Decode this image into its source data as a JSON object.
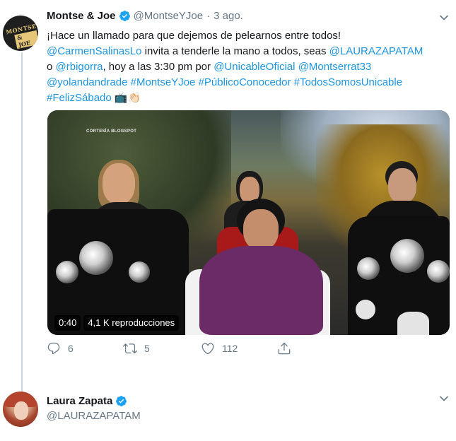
{
  "tweet": {
    "author_name": "Montse & Joe",
    "author_handle": "@MontseYJoe",
    "separator": "·",
    "time": "3 ago.",
    "avatar_text_top": "MONTSE",
    "avatar_text_bottom": "& JOE",
    "text_lines": [
      [
        {
          "t": "¡Hace un llamado para que dejemos de pelearnos entre todos!",
          "link": false
        }
      ],
      [
        {
          "t": "@CarmenSalinasLo",
          "link": true
        },
        {
          "t": " invita a tenderle la mano a todos, seas ",
          "link": false
        },
        {
          "t": "@LAURAZAPATAM",
          "link": true
        }
      ],
      [
        {
          "t": "o ",
          "link": false
        },
        {
          "t": "@rbigorra",
          "link": true
        },
        {
          "t": ", hoy a las 3:30 pm por ",
          "link": false
        },
        {
          "t": "@UnicableOficial",
          "link": true
        },
        {
          "t": " ",
          "link": false
        },
        {
          "t": "@Montserrat33",
          "link": true
        }
      ],
      [
        {
          "t": "@yolandandrade",
          "link": true
        },
        {
          "t": " ",
          "link": false
        },
        {
          "t": "#MontseYJoe",
          "link": true
        },
        {
          "t": " ",
          "link": false
        },
        {
          "t": "#PúblicoConocedor",
          "link": true
        },
        {
          "t": " ",
          "link": false
        },
        {
          "t": "#TodosSomosUnicable",
          "link": true
        }
      ],
      [
        {
          "t": "#FelizSábado",
          "link": true
        },
        {
          "t": " 📺👏🏻",
          "link": false
        }
      ]
    ],
    "video": {
      "watermark": "CORTESÍA BLOGSPOT",
      "duration": "0:40",
      "views": "4,1 K reproducciones"
    },
    "actions": {
      "reply_count": "6",
      "retweet_count": "5",
      "like_count": "112"
    }
  },
  "next_tweet": {
    "author_name": "Laura Zapata",
    "author_handle": "@LAURAZAPATAM"
  },
  "colors": {
    "link": "#1b95e0",
    "verified": "#1da1f2",
    "muted": "#657786",
    "thread_line": "#ccd6dd"
  },
  "icons": [
    "verified-icon",
    "chevron-down-icon",
    "reply-icon",
    "retweet-icon",
    "like-icon",
    "share-icon"
  ]
}
